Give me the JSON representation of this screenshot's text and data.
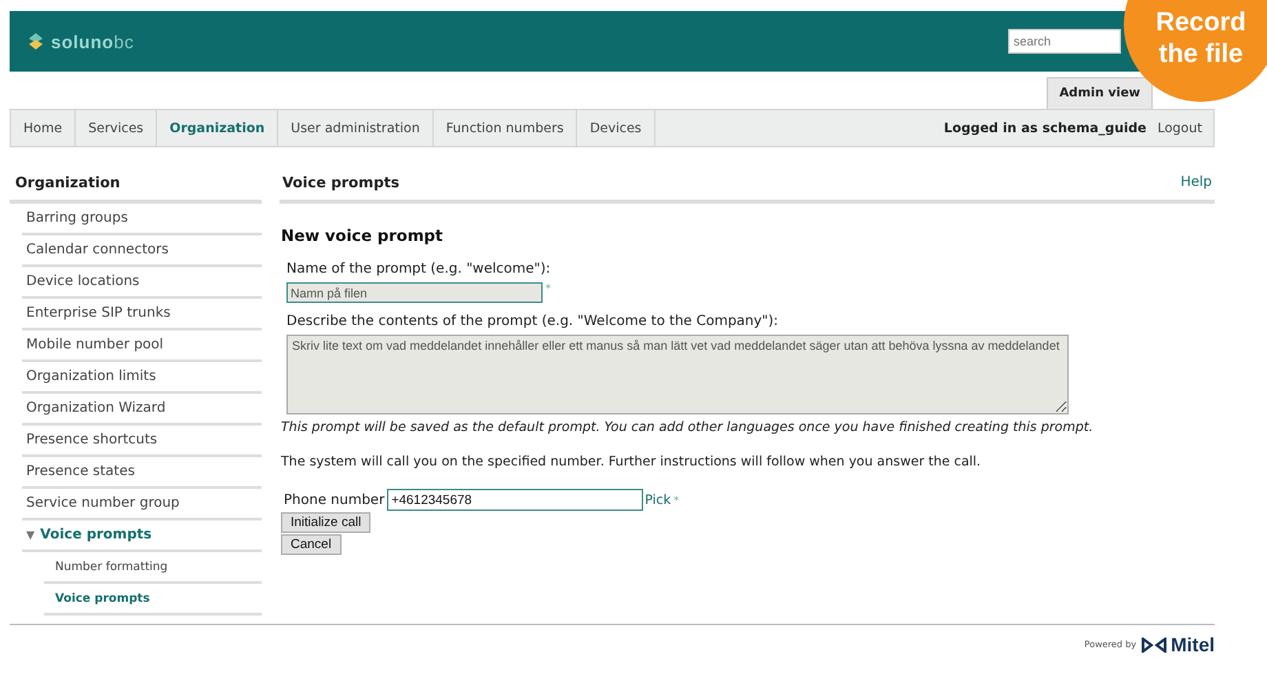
{
  "header": {
    "logo": {
      "main": "soluno",
      "suffix": "bc"
    },
    "search": {
      "placeholder": "search"
    },
    "view_tab": "Admin view"
  },
  "callout": {
    "text": "Record the file"
  },
  "nav": {
    "items": [
      {
        "label": "Home",
        "selected": false
      },
      {
        "label": "Services",
        "selected": false
      },
      {
        "label": "Organization",
        "selected": true
      },
      {
        "label": "User administration",
        "selected": false
      },
      {
        "label": "Function numbers",
        "selected": false
      },
      {
        "label": "Devices",
        "selected": false
      }
    ],
    "user": "Logged in as schema_guide",
    "logout": "Logout"
  },
  "sidebar": {
    "title": "Organization",
    "items": [
      {
        "label": "Barring groups",
        "selected": false
      },
      {
        "label": "Calendar connectors",
        "selected": false
      },
      {
        "label": "Device locations",
        "selected": false
      },
      {
        "label": "Enterprise SIP trunks",
        "selected": false
      },
      {
        "label": "Mobile number pool",
        "selected": false
      },
      {
        "label": "Organization limits",
        "selected": false
      },
      {
        "label": "Organization Wizard",
        "selected": false
      },
      {
        "label": "Presence shortcuts",
        "selected": false
      },
      {
        "label": "Presence states",
        "selected": false
      },
      {
        "label": "Service number group",
        "selected": false
      },
      {
        "label": "Voice prompts",
        "selected": true,
        "expanded": true,
        "expander": "▼",
        "children": [
          {
            "label": "Number formatting",
            "selected": false
          },
          {
            "label": "Voice prompts",
            "selected": true
          }
        ]
      }
    ]
  },
  "content": {
    "title": "Voice prompts",
    "help": "Help",
    "heading": "New voice prompt",
    "name_label": "Name of the prompt (e.g. \"welcome\"):",
    "name_value": "Namn på filen",
    "name_required": "*",
    "desc_label": "Describe the contents of the prompt (e.g. \"Welcome to the Company\"):",
    "desc_value": "Skriv lite text om vad meddelandet innehåller eller ett manus så man lätt vet vad meddelandet säger utan att behöva lyssna av meddelandet",
    "note": "This prompt will be saved as the default prompt. You can add other languages once you have finished creating this prompt.",
    "info": "The system will call you on the specified number. Further instructions will follow when you answer the call.",
    "phone_label": "Phone number",
    "phone_value": "+4612345678",
    "pick": "Pick",
    "phone_required": "*",
    "buttons": [
      "Initialize call",
      "Cancel"
    ]
  },
  "footer": {
    "powered_by": "Powered by",
    "brand": "Mitel"
  }
}
